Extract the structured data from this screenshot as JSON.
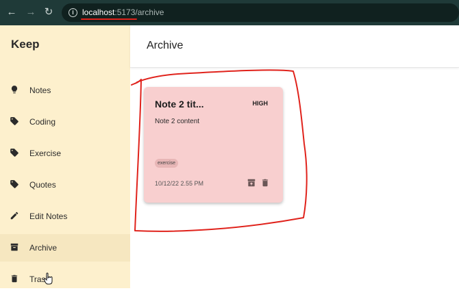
{
  "browser": {
    "url_host": "localhost",
    "url_path": ":5173/archive"
  },
  "sidebar": {
    "title": "Keep",
    "items": [
      {
        "label": "Notes",
        "icon": "lightbulb-icon"
      },
      {
        "label": "Coding",
        "icon": "tag-icon"
      },
      {
        "label": "Exercise",
        "icon": "tag-icon"
      },
      {
        "label": "Quotes",
        "icon": "tag-icon"
      },
      {
        "label": "Edit Notes",
        "icon": "pencil-icon"
      },
      {
        "label": "Archive",
        "icon": "archive-icon"
      },
      {
        "label": "Trash",
        "icon": "trash-icon"
      }
    ]
  },
  "header": {
    "title": "Archive"
  },
  "notes": [
    {
      "title": "Note 2 tit...",
      "priority": "HIGH",
      "content": "Note 2 content",
      "tag": "exercise",
      "date": "10/12/22 2.55 PM"
    }
  ],
  "colors": {
    "sidebar_bg": "#fdf0cd",
    "note_bg": "#f8cfcf",
    "annotation": "#e0221b"
  }
}
